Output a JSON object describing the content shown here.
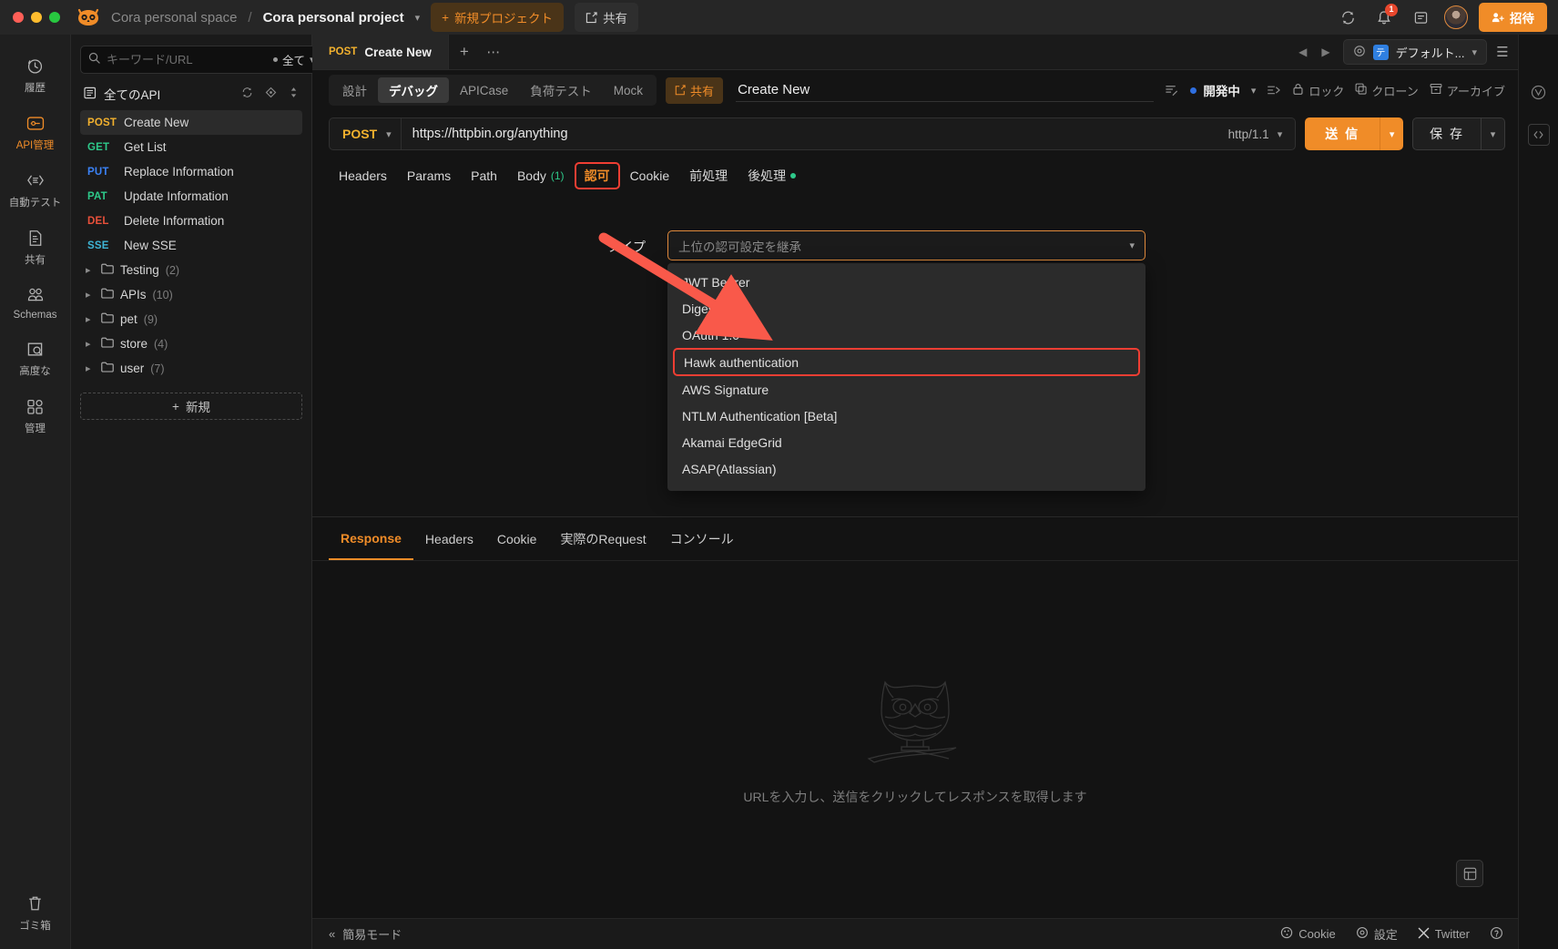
{
  "titlebar": {
    "workspace": "Cora personal space",
    "separator": "/",
    "project": "Cora personal project",
    "new_project_label": "新規プロジェクト",
    "share_label": "共有",
    "invite_label": "招待",
    "notification_count": "1",
    "icons": [
      "sync-icon",
      "bell-icon",
      "panel-icon",
      "avatar"
    ]
  },
  "rail": {
    "items": [
      {
        "label": "履歴",
        "icon": "history-icon",
        "active": false
      },
      {
        "label": "API管理",
        "icon": "api-manage-icon",
        "active": true
      },
      {
        "label": "自動テスト",
        "icon": "auto-test-icon",
        "active": false
      },
      {
        "label": "共有",
        "icon": "share-doc-icon",
        "active": false
      },
      {
        "label": "Schemas",
        "icon": "schemas-icon",
        "active": false
      },
      {
        "label": "高度な",
        "icon": "advanced-icon",
        "active": false
      },
      {
        "label": "管理",
        "icon": "manage-icon",
        "active": false
      }
    ],
    "trash_label": "ゴミ箱"
  },
  "apilist": {
    "search_placeholder": "キーワード/URL",
    "filter_label": "全て",
    "add_button": "+",
    "all_api_label": "全てのAPI",
    "apis": [
      {
        "method": "POST",
        "name": "Create New",
        "cls": "m-post",
        "selected": true
      },
      {
        "method": "GET",
        "name": "Get List",
        "cls": "m-get",
        "selected": false
      },
      {
        "method": "PUT",
        "name": "Replace Information",
        "cls": "m-put",
        "selected": false
      },
      {
        "method": "PAT",
        "name": "Update Information",
        "cls": "m-pat",
        "selected": false
      },
      {
        "method": "DEL",
        "name": "Delete Information",
        "cls": "m-del",
        "selected": false
      },
      {
        "method": "SSE",
        "name": "New SSE",
        "cls": "m-sse",
        "selected": false
      }
    ],
    "folders": [
      {
        "name": "Testing",
        "count": "(2)"
      },
      {
        "name": "APIs",
        "count": "(10)"
      },
      {
        "name": "pet",
        "count": "(9)"
      },
      {
        "name": "store",
        "count": "(4)"
      },
      {
        "name": "user",
        "count": "(7)"
      }
    ],
    "new_label": "新規"
  },
  "doctab": {
    "method": "POST",
    "title": "Create New"
  },
  "environment": {
    "name": "デフォルト...",
    "badge": "テ"
  },
  "modes": {
    "items": [
      {
        "label": "設計",
        "active": false
      },
      {
        "label": "デバッグ",
        "active": true
      },
      {
        "label": "APICase",
        "active": false
      },
      {
        "label": "負荷テスト",
        "active": false
      },
      {
        "label": "Mock",
        "active": false
      }
    ],
    "share_label": "共有"
  },
  "request_name": "Create New",
  "status": {
    "label": "開発中",
    "lock_label": "ロック",
    "clone_label": "クローン",
    "archive_label": "アーカイブ"
  },
  "url_bar": {
    "method": "POST",
    "url": "https://httpbin.org/anything",
    "protocol": "http/1.1",
    "send_label": "送 信",
    "save_label": "保 存"
  },
  "request_tabs": [
    {
      "label": "Headers",
      "count": "",
      "highlight": false,
      "dot": false
    },
    {
      "label": "Params",
      "count": "",
      "highlight": false,
      "dot": false
    },
    {
      "label": "Path",
      "count": "",
      "highlight": false,
      "dot": false
    },
    {
      "label": "Body",
      "count": "(1)",
      "highlight": false,
      "dot": false
    },
    {
      "label": "認可",
      "count": "",
      "highlight": true,
      "dot": false
    },
    {
      "label": "Cookie",
      "count": "",
      "highlight": false,
      "dot": false
    },
    {
      "label": "前処理",
      "count": "",
      "highlight": false,
      "dot": false
    },
    {
      "label": "後処理",
      "count": "",
      "highlight": false,
      "dot": true
    }
  ],
  "auth": {
    "type_label": "タイプ",
    "selected_placeholder": "上位の認可設定を継承",
    "options": [
      {
        "label": "JWT Bearer",
        "highlight": false
      },
      {
        "label": "Digest auth",
        "highlight": false
      },
      {
        "label": "OAuth 1.0",
        "highlight": false
      },
      {
        "label": "Hawk authentication",
        "highlight": true
      },
      {
        "label": "AWS Signature",
        "highlight": false
      },
      {
        "label": "NTLM Authentication [Beta]",
        "highlight": false
      },
      {
        "label": "Akamai EdgeGrid",
        "highlight": false
      },
      {
        "label": "ASAP(Atlassian)",
        "highlight": false
      }
    ]
  },
  "response": {
    "tabs": [
      {
        "label": "Response",
        "active": true
      },
      {
        "label": "Headers",
        "active": false
      },
      {
        "label": "Cookie",
        "active": false
      },
      {
        "label": "実際のRequest",
        "active": false
      },
      {
        "label": "コンソール",
        "active": false
      }
    ],
    "empty_text": "URLを入力し、送信をクリックしてレスポンスを取得します"
  },
  "statusbar": {
    "simple_mode": "簡易モード",
    "cookie": "Cookie",
    "settings": "設定",
    "twitter": "Twitter"
  },
  "colors": {
    "accent": "#f08c28",
    "highlight_red": "#ef3e33",
    "status_blue": "#2f6fe0",
    "green": "#2ec98a"
  }
}
